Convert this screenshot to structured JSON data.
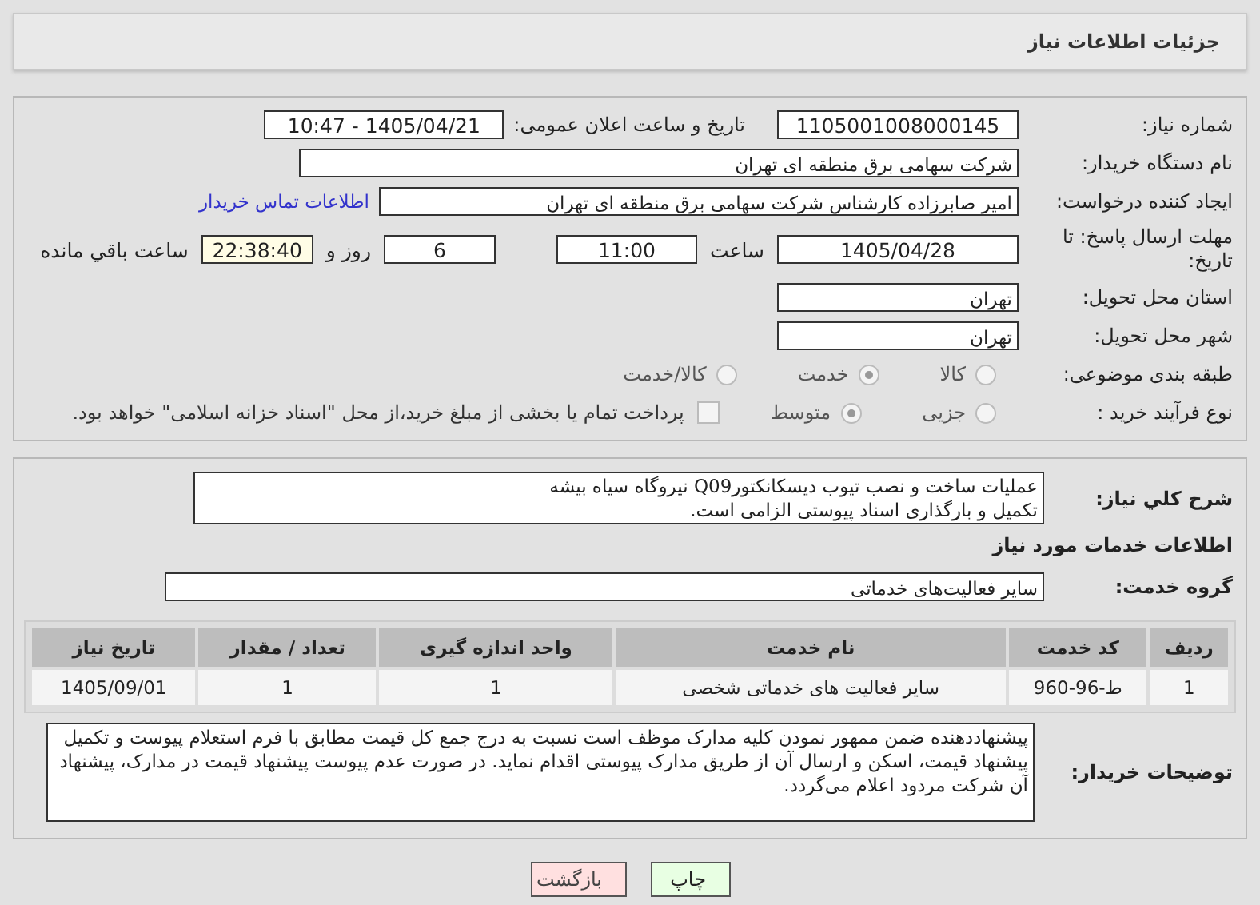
{
  "header": {
    "title": "جزئیات اطلاعات نیاز"
  },
  "need_number": {
    "label": "شماره نیاز:",
    "value": "1105001008000145"
  },
  "announce": {
    "label": "تاریخ و ساعت اعلان عمومی:",
    "value": "1405/04/21 - 10:47"
  },
  "buyer_org": {
    "label": "نام دستگاه خریدار:",
    "value": "شرکت سهامی برق منطقه ای تهران"
  },
  "requester": {
    "label": "ایجاد کننده درخواست:",
    "value": "امیر صابرزاده کارشناس شرکت سهامی برق منطقه ای تهران",
    "link": "اطلاعات تماس خریدار"
  },
  "deadline": {
    "label": "مهلت ارسال پاسخ: تا تاریخ:",
    "date": "1405/04/28",
    "time_label": "ساعت",
    "time": "11:00",
    "days": "6",
    "days_label": "روز و",
    "remaining": "22:38:40",
    "remaining_label": "ساعت باقي مانده"
  },
  "province": {
    "label": "استان محل تحویل:",
    "value": "تهران"
  },
  "city": {
    "label": "شهر محل تحویل:",
    "value": "تهران"
  },
  "category": {
    "label": "طبقه بندی موضوعی:",
    "options": [
      {
        "label": "کالا",
        "selected": false
      },
      {
        "label": "خدمت",
        "selected": true
      },
      {
        "label": "کالا/خدمت",
        "selected": false
      }
    ]
  },
  "process": {
    "label": "نوع فرآیند خرید :",
    "options": [
      {
        "label": "جزیی",
        "selected": false
      },
      {
        "label": "متوسط",
        "selected": true
      }
    ],
    "treasury": {
      "label": "پرداخت تمام یا بخشی از مبلغ خرید،از محل \"اسناد خزانه اسلامی\" خواهد بود.",
      "checked": false
    }
  },
  "description": {
    "label": "شرح کلي نياز:",
    "value": "عملیات ساخت و نصب تیوب دیسکانکتورQ09 نیروگاه سیاه بیشه\nتکمیل و بارگذاری اسناد پیوستی الزامی است."
  },
  "services_heading": "اطلاعات خدمات مورد نیاز",
  "service_group": {
    "label": "گروه خدمت:",
    "value": "سایر فعالیت‌های خدماتی"
  },
  "table": {
    "columns": [
      "ردیف",
      "کد خدمت",
      "نام خدمت",
      "واحد اندازه گیری",
      "تعداد / مقدار",
      "تاریخ نیاز"
    ],
    "rows": [
      [
        "1",
        "ط-96-960",
        "سایر فعالیت های خدماتی شخصی",
        "1",
        "1",
        "1405/09/01"
      ]
    ]
  },
  "buyer_notes": {
    "label": "توضیحات خریدار:",
    "value": "پیشنهاددهنده ضمن ممهور نمودن کلیه مدارک موظف است نسبت به درج جمع کل قیمت مطابق با فرم استعلام پیوست و تکمیل پیشنهاد قیمت، اسکن و ارسال آن از طریق مدارک پیوستی اقدام نماید. در صورت عدم پیوست پیشنهاد قیمت در مدارک، پیشنهاد آن شرکت مردود اعلام می‌گردد."
  },
  "buttons": [
    {
      "label": "چاپ",
      "kind": "print"
    },
    {
      "label": "بازگشت",
      "kind": "back"
    }
  ]
}
